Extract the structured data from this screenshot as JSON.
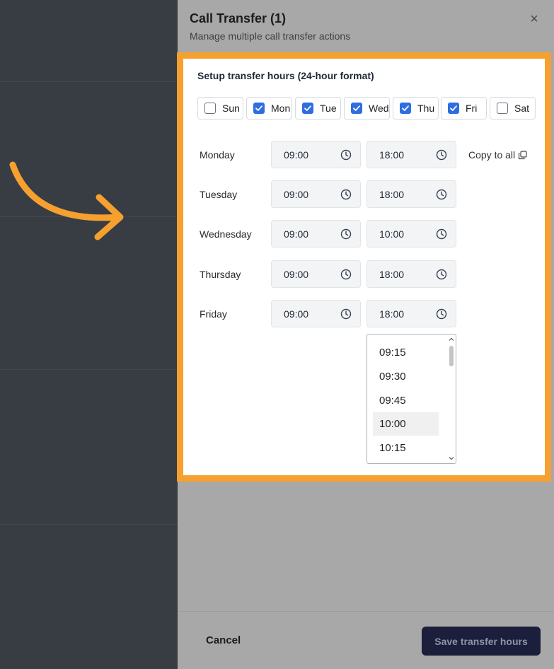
{
  "drawer": {
    "title": "Call Transfer (1)",
    "subtitle": "Manage multiple call transfer actions",
    "close_glyph": "×"
  },
  "panel": {
    "title": "Setup transfer hours (24-hour format)"
  },
  "days": [
    {
      "label": "Sun",
      "checked": false
    },
    {
      "label": "Mon",
      "checked": true
    },
    {
      "label": "Tue",
      "checked": true
    },
    {
      "label": "Wed",
      "checked": true
    },
    {
      "label": "Thu",
      "checked": true
    },
    {
      "label": "Fri",
      "checked": true
    },
    {
      "label": "Sat",
      "checked": false
    }
  ],
  "schedule": [
    {
      "day": "Monday",
      "start": "09:00",
      "end": "18:00"
    },
    {
      "day": "Tuesday",
      "start": "09:00",
      "end": "18:00"
    },
    {
      "day": "Wednesday",
      "start": "09:00",
      "end": "10:00"
    },
    {
      "day": "Thursday",
      "start": "09:00",
      "end": "18:00"
    },
    {
      "day": "Friday",
      "start": "09:00",
      "end": "18:00"
    }
  ],
  "copy_all_label": "Copy to all",
  "dropdown": {
    "options": [
      "09:15",
      "09:30",
      "09:45",
      "10:00",
      "10:15"
    ],
    "selected": "10:00"
  },
  "footer": {
    "cancel_label": "Cancel",
    "save_label": "Save transfer hours"
  },
  "colors": {
    "accent": "#2f6de0",
    "highlight": "#f6a02f",
    "save_bg": "#1b1f3b"
  },
  "icons": {
    "clock": "clock-icon",
    "copy": "copy-icon",
    "close": "close-icon",
    "check": "check-icon",
    "arrow": "arrow-right-icon"
  }
}
